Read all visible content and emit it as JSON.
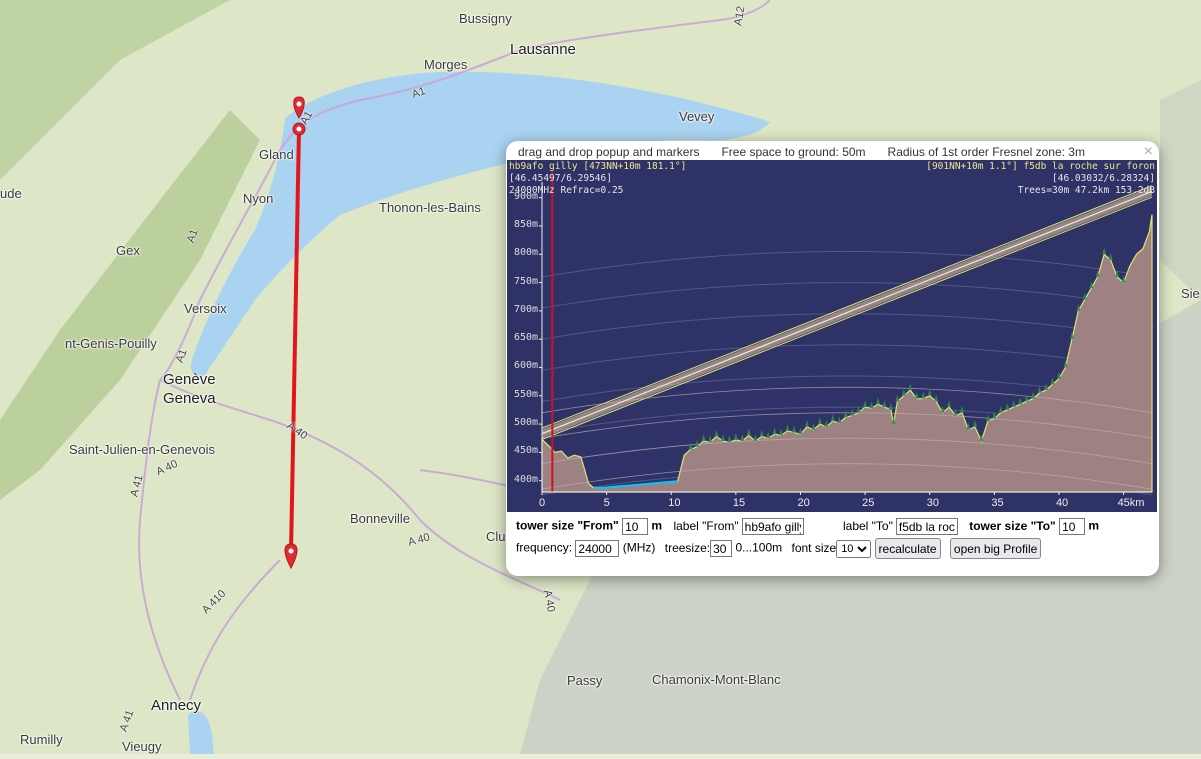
{
  "map": {
    "places": [
      {
        "id": "bussigny",
        "name": "Bussigny"
      },
      {
        "id": "lausanne",
        "name": "Lausanne"
      },
      {
        "id": "morges",
        "name": "Morges"
      },
      {
        "id": "vevey",
        "name": "Vevey"
      },
      {
        "id": "gland",
        "name": "Gland"
      },
      {
        "id": "nyon",
        "name": "Nyon"
      },
      {
        "id": "ude",
        "name": "ude"
      },
      {
        "id": "gex",
        "name": "Gex"
      },
      {
        "id": "thonon",
        "name": "Thonon-les-Bains"
      },
      {
        "id": "versoix",
        "name": "Versoix"
      },
      {
        "id": "genis",
        "name": "nt-Genis-Pouilly"
      },
      {
        "id": "geneve",
        "name": "Genève"
      },
      {
        "id": "geneva",
        "name": "Geneva"
      },
      {
        "id": "julien",
        "name": "Saint-Julien-en-Genevois"
      },
      {
        "id": "bonneville",
        "name": "Bonneville"
      },
      {
        "id": "clu",
        "name": "Clu"
      },
      {
        "id": "passy",
        "name": "Passy"
      },
      {
        "id": "chamonix",
        "name": "Chamonix-Mont-Blanc"
      },
      {
        "id": "annecy",
        "name": "Annecy"
      },
      {
        "id": "rumilly",
        "name": "Rumilly"
      },
      {
        "id": "vieugy",
        "name": "Vieugy"
      },
      {
        "id": "sie",
        "name": "Sie"
      }
    ],
    "roads": [
      {
        "id": "a1a",
        "name": "A1"
      },
      {
        "id": "a1b",
        "name": "A1"
      },
      {
        "id": "a1c",
        "name": "A1"
      },
      {
        "id": "a1d",
        "name": "A1"
      },
      {
        "id": "a12",
        "name": "A12"
      },
      {
        "id": "a40a",
        "name": "A 40"
      },
      {
        "id": "a40b",
        "name": "A 40"
      },
      {
        "id": "a40c",
        "name": "A 40"
      },
      {
        "id": "a40d",
        "name": "A 40"
      },
      {
        "id": "a41a",
        "name": "A 41"
      },
      {
        "id": "a41b",
        "name": "A 41"
      },
      {
        "id": "a410",
        "name": "A 410"
      }
    ],
    "colors": {
      "lake": "#a9d3f0",
      "terrain": "#dfe7c8",
      "link_line": "#e0161c",
      "marker": "#e02b35"
    }
  },
  "popup": {
    "title": "drag and drop popup and markers",
    "free_space": "Free space to ground: 50m",
    "fresnel": "Radius of 1st order Fresnel zone: 3m",
    "close": "×",
    "profile": {
      "from_line": "hb9afo gilly [473NN+10m 181.1°]",
      "to_line": "[901NN+10m 1.1°] f5db la roche sur foron",
      "from_coords": "[46.45497/6.29546]",
      "to_coords": "[46.03032/6.28324]",
      "freq_line": "24000MHz Refrac=0.25",
      "trees_line": "Trees=30m 47.2km 153.2dB"
    }
  },
  "chart_data": {
    "type": "area",
    "xlabel": "",
    "ylabel": "",
    "xlim": [
      0,
      47.2
    ],
    "ylim": [
      380,
      910
    ],
    "x_ticks": [
      "0",
      "5",
      "10",
      "15",
      "20",
      "25",
      "30",
      "35",
      "40",
      "45km"
    ],
    "x_tick_values": [
      0,
      5,
      10,
      15,
      20,
      25,
      30,
      35,
      40,
      45
    ],
    "y_ticks": [
      "400m",
      "450m",
      "500m",
      "550m",
      "600m",
      "650m",
      "700m",
      "750m",
      "800m",
      "850m",
      "900m"
    ],
    "y_tick_values": [
      400,
      450,
      500,
      550,
      600,
      650,
      700,
      750,
      800,
      850,
      900
    ],
    "terrain": {
      "x": [
        0,
        0.5,
        1,
        1.5,
        2,
        2.5,
        3,
        3.3,
        3.6,
        4,
        5,
        6,
        7,
        8,
        9,
        10,
        10.5,
        11,
        11.5,
        12,
        12.5,
        13,
        13.5,
        14,
        14.5,
        15,
        15.5,
        16,
        16.5,
        17,
        17.5,
        18,
        18.5,
        19,
        19.5,
        20,
        20.5,
        21,
        21.5,
        22,
        22.5,
        23,
        23.5,
        24,
        24.5,
        25,
        25.5,
        26,
        26.5,
        27,
        27.2,
        27.5,
        28,
        28.5,
        29,
        29.5,
        30,
        30.5,
        31,
        31.5,
        32,
        32.5,
        33,
        33.5,
        34,
        34.5,
        35,
        35.5,
        36,
        36.5,
        37,
        37.5,
        38,
        38.5,
        39,
        39.5,
        40,
        40.5,
        41,
        41.5,
        42,
        42.5,
        43,
        43.5,
        44,
        44.5,
        45,
        45.5,
        46,
        46.5,
        47,
        47.2
      ],
      "y": [
        473,
        462,
        450,
        452,
        440,
        445,
        442,
        420,
        395,
        387,
        388,
        390,
        392,
        394,
        396,
        398,
        399,
        445,
        455,
        460,
        470,
        468,
        478,
        470,
        468,
        472,
        470,
        480,
        470,
        478,
        475,
        482,
        480,
        488,
        485,
        482,
        495,
        490,
        500,
        495,
        505,
        502,
        512,
        515,
        520,
        530,
        528,
        535,
        530,
        525,
        500,
        540,
        550,
        560,
        545,
        545,
        550,
        540,
        520,
        530,
        515,
        520,
        490,
        495,
        470,
        505,
        510,
        520,
        525,
        530,
        535,
        540,
        545,
        555,
        560,
        570,
        580,
        600,
        650,
        700,
        720,
        740,
        760,
        800,
        790,
        760,
        750,
        780,
        800,
        810,
        840,
        870,
        900
      ],
      "color": "#9e8283"
    },
    "trees": {
      "height_m": 30,
      "color": "#2e8b57"
    },
    "los_line": {
      "from": 483,
      "to": 911,
      "color": "#f3e7d1"
    },
    "fresnel_band": {
      "color": "#e8c8a0"
    },
    "water_segments": [
      [
        4,
        10.5
      ]
    ],
    "marker_x": 0.8,
    "colors": {
      "background": "#2e3266",
      "water": "#00c8ff",
      "marker": "#d0141c"
    }
  },
  "controls": {
    "tower_from_label": "tower size \"From\"",
    "tower_from_value": "10",
    "m1": "m",
    "label_from": "label \"From\"",
    "label_from_value": "hb9afo gilly",
    "label_to": "label \"To\"",
    "label_to_value": "f5db la roche sur foron",
    "tower_to_label": "tower size \"To\"",
    "tower_to_value": "10",
    "m2": "m",
    "frequency_label": "frequency:",
    "frequency_value": "24000",
    "mhz": "(MHz)",
    "treesize_label": "treesize:",
    "treesize_value": "30",
    "treesize_range": "0...100m",
    "fontsize_label": "font size",
    "fontsize_value": "10",
    "recalc": "recalculate",
    "open_big": "open big Profile"
  }
}
